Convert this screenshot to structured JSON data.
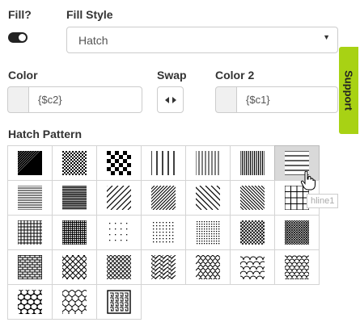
{
  "fill": {
    "label": "Fill?",
    "enabled": true
  },
  "fill_style": {
    "label": "Fill Style",
    "value": "Hatch"
  },
  "color": {
    "label": "Color",
    "value": "{$c2}"
  },
  "swap": {
    "label": "Swap"
  },
  "color2": {
    "label": "Color 2",
    "value": "{$c1}"
  },
  "support_tab": {
    "label": "Support"
  },
  "hatch": {
    "label": "Hatch Pattern",
    "tooltip": "hline1",
    "rows": [
      [
        "solid-dense",
        "checker-fine",
        "checker-large",
        "vline-wide",
        "vline-medium",
        "vline-fine",
        "hline1"
      ],
      [
        "hline-fine",
        "hline-dense",
        "diag-right-wide",
        "diag-right-medium",
        "diag-left-wide",
        "diag-left-medium",
        "grid-wide"
      ],
      [
        "grid-medium",
        "grid-fine",
        "dots-sparse",
        "dots-medium",
        "dots-dense",
        "diag-cross-fine",
        "diag-cross-dense"
      ],
      [
        "brick",
        "diamond-lattice",
        "diamond-small",
        "zigzag-vertical",
        "weave",
        "scales-large",
        "scales-small"
      ],
      [
        "chainmail",
        "net",
        "maze"
      ]
    ],
    "selected": "hline1"
  }
}
